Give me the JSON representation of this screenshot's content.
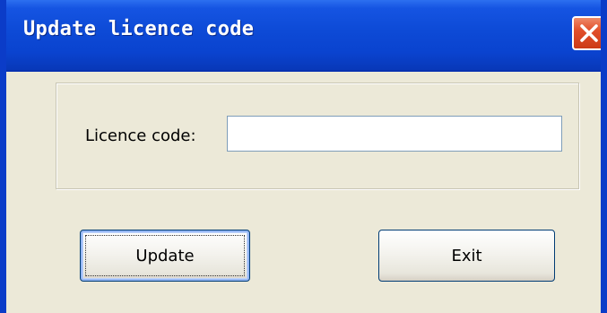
{
  "window": {
    "title": "Update licence code"
  },
  "titlebar_buttons": {
    "close_icon": "close-x-icon"
  },
  "form": {
    "licence_code_label": "Licence code:",
    "licence_code_value": ""
  },
  "buttons": {
    "update_label": "Update",
    "exit_label": "Exit"
  },
  "colors": {
    "titlebar": "#0a43cf",
    "window_bg": "#ece9d8",
    "close_button": "#e1502c",
    "button_border": "#003c74"
  }
}
